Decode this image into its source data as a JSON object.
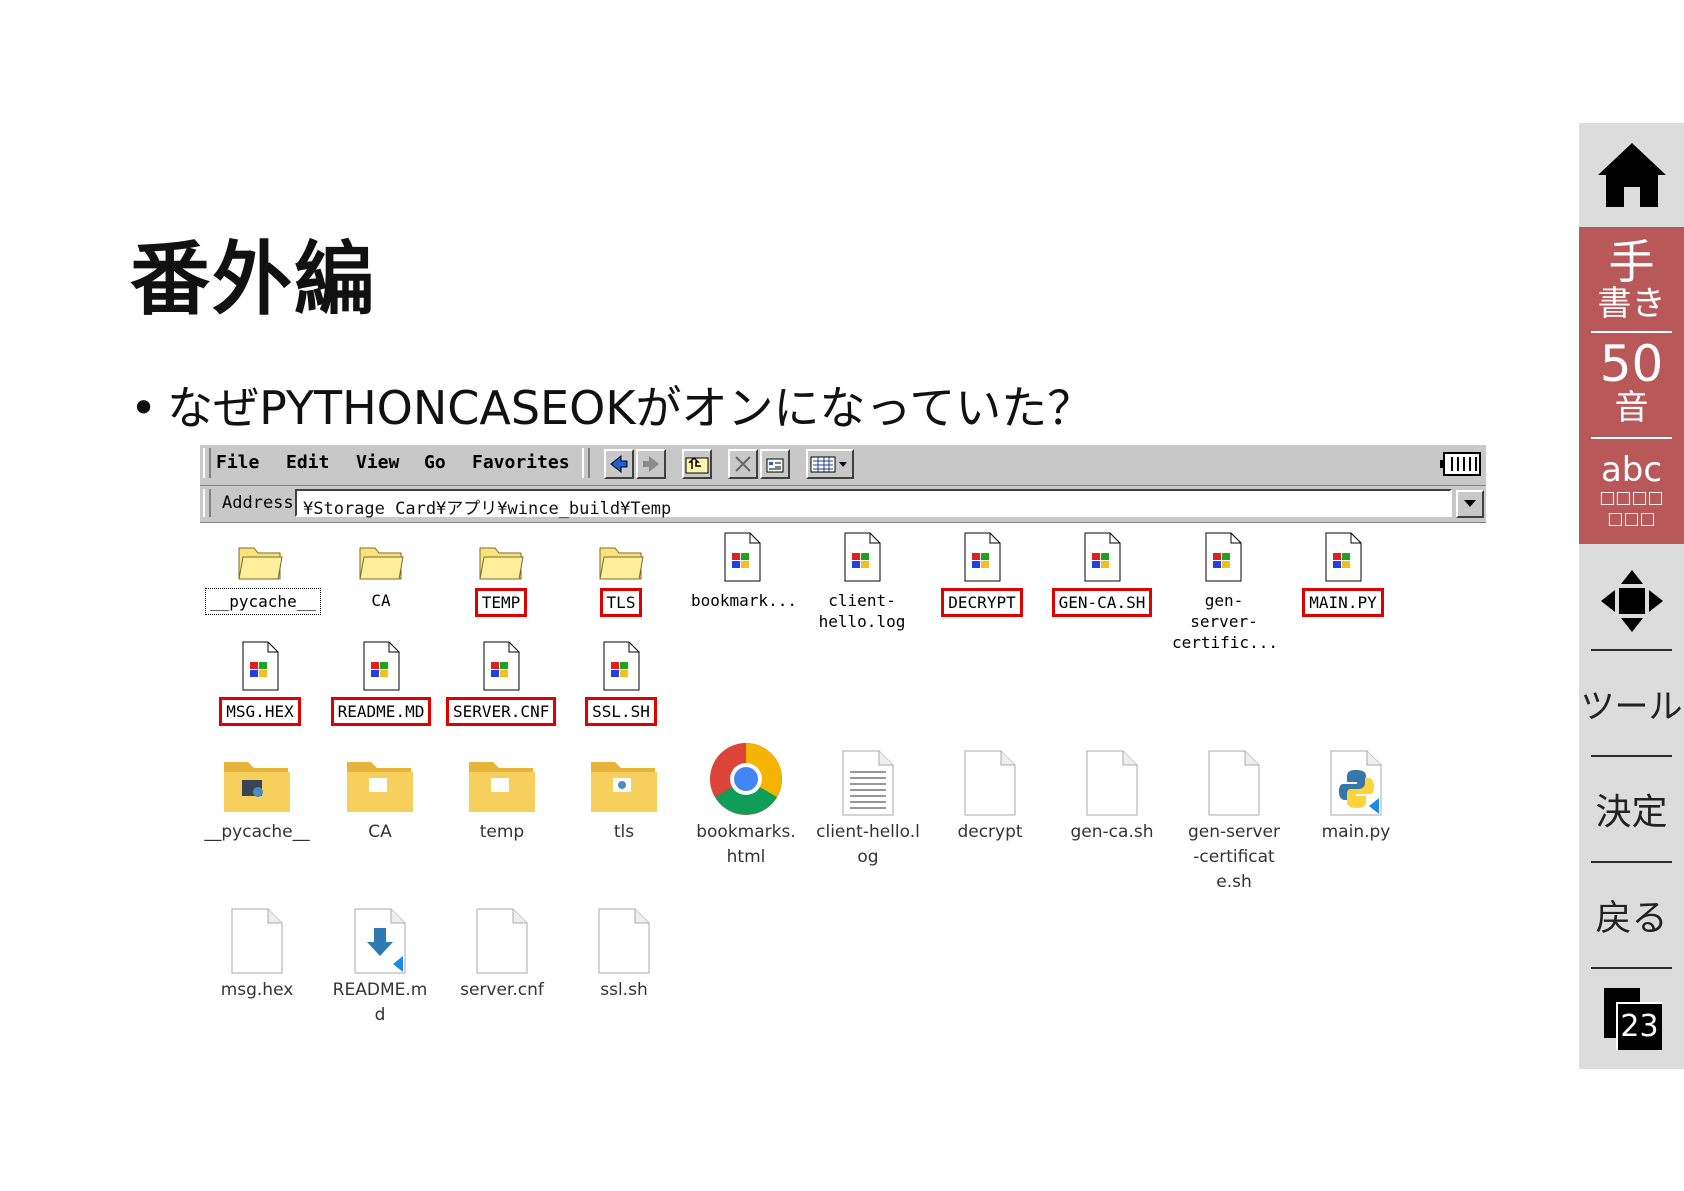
{
  "slide": {
    "title": "番外編",
    "bullet": "なぜPYTHONCASEOKがオンになっていた？"
  },
  "sidebar": {
    "handwriting_top": "手",
    "handwriting_bottom": "書き",
    "kana_top": "50",
    "kana_bottom": "音",
    "abc_top": "abc",
    "abc_row1": "□□□□",
    "abc_row2": "□□□",
    "tools": "ツール",
    "decide": "決定",
    "back": "戻る",
    "page_number": "23"
  },
  "wince": {
    "menus": [
      "File",
      "Edit",
      "View",
      "Go",
      "Favorites"
    ],
    "address_label": "Address",
    "address_value": "¥Storage Card¥アプリ¥wince_build¥Temp",
    "items": [
      {
        "label": "__pycache__",
        "type": "folder",
        "style": "dotted"
      },
      {
        "label": "CA",
        "type": "folder",
        "style": "plain"
      },
      {
        "label": "TEMP",
        "type": "folder",
        "style": "red"
      },
      {
        "label": "TLS",
        "type": "folder",
        "style": "red"
      },
      {
        "label": "bookmark...",
        "type": "file",
        "style": "plain"
      },
      {
        "label": "client-hello.log",
        "type": "file",
        "style": "plain"
      },
      {
        "label": "DECRYPT",
        "type": "file",
        "style": "red"
      },
      {
        "label": "GEN-CA.SH",
        "type": "file",
        "style": "red"
      },
      {
        "label": "gen-server-certific...",
        "type": "file",
        "style": "plain"
      },
      {
        "label": "MAIN.PY",
        "type": "file",
        "style": "red"
      },
      {
        "label": "MSG.HEX",
        "type": "file",
        "style": "red"
      },
      {
        "label": "README.MD",
        "type": "file",
        "style": "red"
      },
      {
        "label": "SERVER.CNF",
        "type": "file",
        "style": "red"
      },
      {
        "label": "SSL.SH",
        "type": "file",
        "style": "red"
      }
    ]
  },
  "win10": {
    "items": [
      {
        "label": "__pycache__",
        "icon": "folder-pycache-icon"
      },
      {
        "label": "CA",
        "icon": "folder-icon"
      },
      {
        "label": "temp",
        "icon": "folder-icon"
      },
      {
        "label": "tls",
        "icon": "folder-tls-icon"
      },
      {
        "label": "bookmarks.html",
        "icon": "chrome-icon"
      },
      {
        "label": "client-hello.log",
        "icon": "text-file-icon"
      },
      {
        "label": "decrypt",
        "icon": "blank-file-icon"
      },
      {
        "label": "gen-ca.sh",
        "icon": "blank-file-icon"
      },
      {
        "label": "gen-server-certificate.sh",
        "icon": "blank-file-icon"
      },
      {
        "label": "main.py",
        "icon": "python-file-icon"
      },
      {
        "label": "msg.hex",
        "icon": "blank-file-icon"
      },
      {
        "label": "README.md",
        "icon": "markdown-file-icon"
      },
      {
        "label": "server.cnf",
        "icon": "blank-file-icon"
      },
      {
        "label": "ssl.sh",
        "icon": "blank-file-icon"
      }
    ]
  },
  "colors": {
    "highlight_red": "#e00000",
    "sidebar_red": "#b85858",
    "sidebar_gray": "#dcdcdc"
  }
}
